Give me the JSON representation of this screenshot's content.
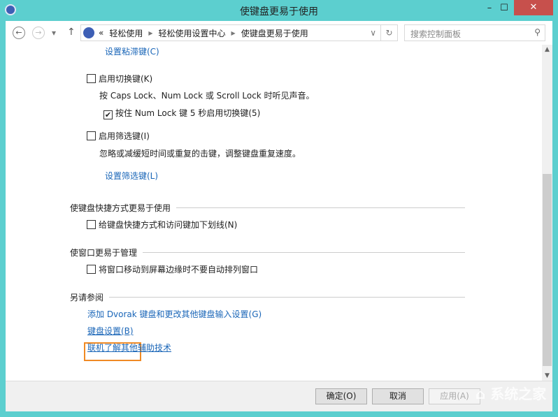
{
  "window": {
    "title": "使键盘更易于使用",
    "minimize": "–",
    "maximize": "☐",
    "close": "✕"
  },
  "nav": {
    "back": "←",
    "forward": "→",
    "dropdown": "▾",
    "up": "↑",
    "breadcrumb": [
      "«",
      "轻松使用",
      "轻松使用设置中心",
      "使键盘更易于使用"
    ],
    "refresh": "↻",
    "address_dropdown": "∨",
    "search_placeholder": "搜索控制面板",
    "search_icon": "⚲"
  },
  "content": {
    "sticky_link": "设置粘滞键(C)",
    "toggle_keys": {
      "label": "启用切换键(K)",
      "checked": false,
      "desc": "按 Caps Lock、Num Lock 或 Scroll Lock 时听见声音。",
      "sub": {
        "label": "按住 Num Lock 键 5 秒启用切换键(5)",
        "checked": true
      }
    },
    "filter_keys": {
      "label": "启用筛选键(I)",
      "checked": false,
      "desc": "忽略或减缓短时间或重复的击键，调整键盘重复速度。",
      "link": "设置筛选键(L)"
    },
    "shortcuts": {
      "header": "使键盘快捷方式更易于使用",
      "option": "给键盘快捷方式和访问键加下划线(N)",
      "checked": false
    },
    "windows": {
      "header": "使窗口更易于管理",
      "option": "将窗口移动到屏幕边缘时不要自动排列窗口",
      "checked": false
    },
    "see_also": {
      "header": "另请参阅",
      "links": [
        "添加 Dvorak 键盘和更改其他键盘输入设置(G)",
        "键盘设置(B)",
        "联机了解其他辅助技术"
      ]
    }
  },
  "footer": {
    "ok": "确定(O)",
    "cancel": "取消",
    "apply": "应用(A)"
  },
  "check_mark": "✔",
  "watermark": "系统之家"
}
